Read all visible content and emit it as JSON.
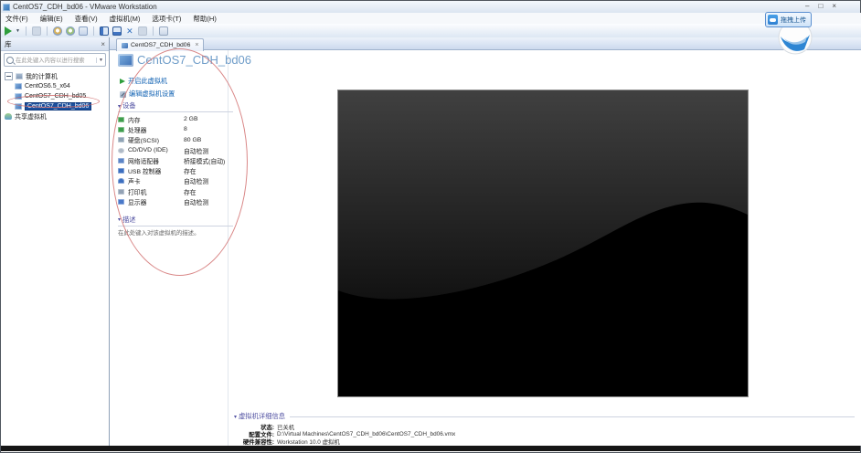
{
  "window": {
    "title": "CentOS7_CDH_bd06 - VMware Workstation",
    "minimize_glyph": "–",
    "maximize_glyph": "□",
    "close_glyph": "×"
  },
  "overlay": {
    "upload_label": "拖拽上传"
  },
  "menu": {
    "items": [
      "文件(F)",
      "编辑(E)",
      "查看(V)",
      "虚拟机(M)",
      "选项卡(T)",
      "帮助(H)"
    ]
  },
  "toolbar": {
    "icons": [
      "power-on",
      "power-dropdown",
      "suspend",
      "snapshot-take",
      "snapshot-revert",
      "snapshot-manager",
      "show-library",
      "show-thumbnail-bar",
      "fullscreen",
      "unity",
      "console-view"
    ]
  },
  "sidebar": {
    "header": "库",
    "close_glyph": "×",
    "search_placeholder": "在此处键入内容以进行搜索",
    "dropdown_glyph": "▼",
    "tree": {
      "root": "我的计算机",
      "items": [
        "CentOS6.5_x64",
        "CentOS7_CDH_bd05",
        "CentOS7_CDH_bd06"
      ],
      "selected_index": 2,
      "shared": "共享虚拟机"
    }
  },
  "tab": {
    "label": "CentOS7_CDH_bd06",
    "close_glyph": "×"
  },
  "vm": {
    "title": "CentOS7_CDH_bd06",
    "power_on": "开启此虚拟机",
    "edit_settings": "编辑虚拟机设置",
    "devices_header": "设备",
    "collapse_glyph": "▾",
    "devices": [
      {
        "icon": "memory-icon",
        "label": "内存",
        "value": "2 GB"
      },
      {
        "icon": "cpu-icon",
        "label": "处理器",
        "value": "8"
      },
      {
        "icon": "disk-icon",
        "label": "硬盘(SCSI)",
        "value": "80 GB"
      },
      {
        "icon": "cd-dvd-icon",
        "label": "CD/DVD (IDE)",
        "value": "自动检测"
      },
      {
        "icon": "network-icon",
        "label": "网络适配器",
        "value": "桥接模式(自动)"
      },
      {
        "icon": "usb-icon",
        "label": "USB 控制器",
        "value": "存在"
      },
      {
        "icon": "sound-icon",
        "label": "声卡",
        "value": "自动检测"
      },
      {
        "icon": "printer-icon",
        "label": "打印机",
        "value": "存在"
      },
      {
        "icon": "display-icon",
        "label": "显示器",
        "value": "自动检测"
      }
    ],
    "description_header": "描述",
    "description_placeholder": "在此处键入对该虚拟机的描述。"
  },
  "details": {
    "header": "虚拟机详细信息",
    "rows": [
      {
        "label": "状态:",
        "value": "已关机"
      },
      {
        "label": "配置文件:",
        "value": "D:\\Virtual Machines\\CentOS7_CDH_bd06\\CentOS7_CDH_bd06.vmx"
      },
      {
        "label": "硬件兼容性:",
        "value": "Workstation 10.0 虚拟机"
      }
    ]
  },
  "colors": {
    "accent_blue": "#2f7fd0",
    "link_blue": "#1464b4",
    "section_purple": "#5353a3",
    "selected_blue": "#1c4f9c",
    "annotation_red": "#d06969"
  }
}
